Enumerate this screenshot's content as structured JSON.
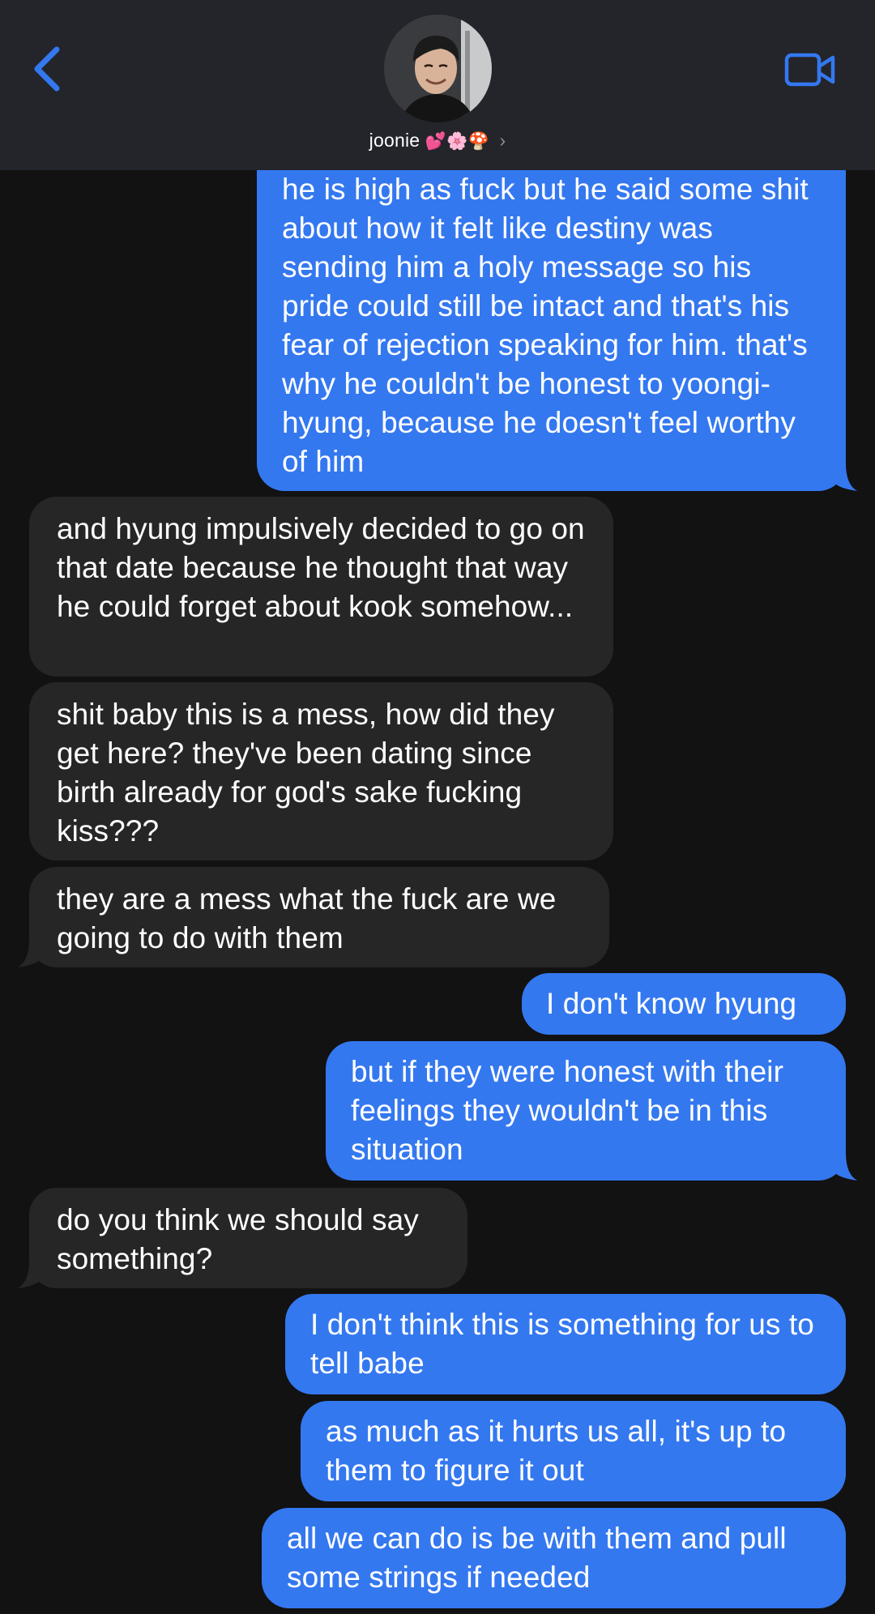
{
  "header": {
    "contact_name": "joonie",
    "contact_emoji": "💕🌸🍄",
    "chevron": "›",
    "icons": {
      "back": "chevron-left-icon",
      "video": "video-camera-icon"
    },
    "accent_color": "#3478f0"
  },
  "messages": [
    {
      "sender": "me",
      "text": "he is high as fuck but he said some shit about how it felt like destiny was sending him a holy message so his pride could still be intact and that's his fear of rejection speaking for him. that's why he couldn't be honest to yoongi-hyung, because he doesn't feel worthy of him"
    },
    {
      "sender": "joonie",
      "text": "and hyung impulsively decided to go on that date because he thought that way he could forget about kook somehow..."
    },
    {
      "sender": "joonie",
      "text": "shit baby this is a mess, how did they get here? they've been dating since birth already for god's sake fucking kiss???"
    },
    {
      "sender": "joonie",
      "text": "they are a mess what the fuck are we going to do with them"
    },
    {
      "sender": "me",
      "text": "I don't know hyung"
    },
    {
      "sender": "me",
      "text": "but if they were honest with their feelings they wouldn't be in this situation"
    },
    {
      "sender": "joonie",
      "text": "do you think we should say something?"
    },
    {
      "sender": "me",
      "text": "I don't think this is something for us to tell babe"
    },
    {
      "sender": "me",
      "text": "as much as it hurts us all, it's up to them to figure it out"
    },
    {
      "sender": "me",
      "text": "all we can do is be with them and pull some strings if needed"
    }
  ]
}
